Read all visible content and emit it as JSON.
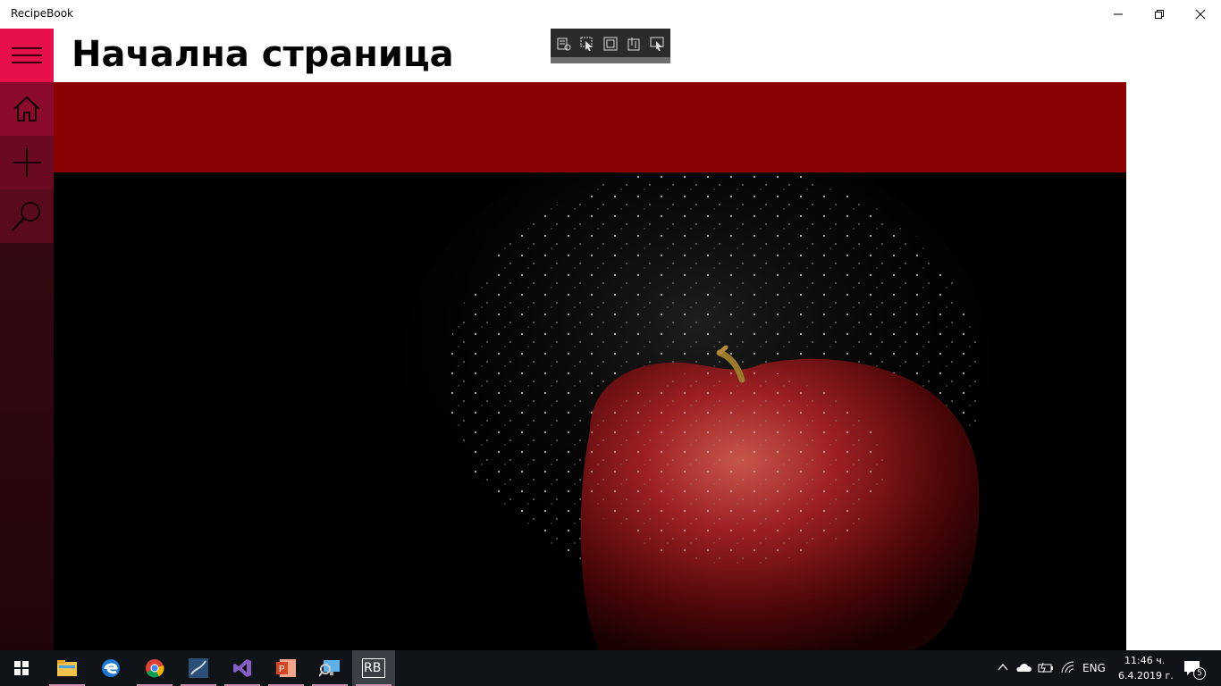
{
  "app": {
    "title": "RecipeBook"
  },
  "window_controls": {
    "minimize_icon": "minimize-icon",
    "restore_icon": "restore-icon",
    "close_icon": "close-icon"
  },
  "header": {
    "title": "Начална страница"
  },
  "sidebar": {
    "items": [
      {
        "name": "hamburger-menu",
        "icon": "hamburger-icon"
      },
      {
        "name": "home",
        "icon": "home-icon"
      },
      {
        "name": "add",
        "icon": "plus-icon"
      },
      {
        "name": "search",
        "icon": "search-icon"
      }
    ]
  },
  "colors": {
    "accent": "#e8104a",
    "band": "#8b0000",
    "sidebar_dark": "#2e0710"
  },
  "taskbar": {
    "apps": [
      "start-icon",
      "file-explorer-icon",
      "edge-icon",
      "chrome-icon",
      "sql-server-icon",
      "visual-studio-icon",
      "powerpoint-icon",
      "remote-desktop-icon",
      "recipebook-icon"
    ],
    "active_app_label": "RB",
    "language": "ENG",
    "time": "11:46 ч.",
    "date": "6.4.2019 г.",
    "notification_count": "5"
  }
}
